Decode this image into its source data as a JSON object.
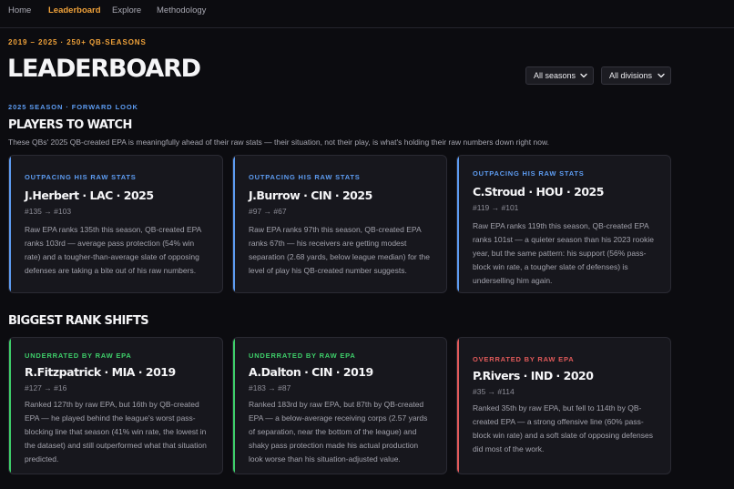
{
  "nav": {
    "items": [
      {
        "label": "Home"
      },
      {
        "label": "Leaderboard"
      },
      {
        "label": "Explore"
      },
      {
        "label": "Methodology"
      }
    ]
  },
  "header": {
    "eyebrow": "2019 – 2025 · 250+ QB-SEASONS",
    "title": "LEADERBOARD"
  },
  "filters": {
    "season": "All seasons",
    "division": "All divisions"
  },
  "colors": {
    "accent": "#f0a23a",
    "underrated": "#5d9cf2",
    "positive": "#3ecf6a",
    "negative": "#e25a5a"
  },
  "players_to_watch": {
    "eyebrow": "2025 SEASON · FORWARD LOOK",
    "title": "PLAYERS TO WATCH",
    "description": "These QBs' 2025 QB-created EPA is meaningfully ahead of their raw stats — their situation, not their play, is what's holding their raw numbers down right now.",
    "cards": [
      {
        "tag": "OUTPACING HIS RAW STATS",
        "name": "J.Herbert · LAC · 2025",
        "rank": "#135 → #103",
        "body": "Raw EPA ranks 135th this season, QB-created EPA ranks 103rd — average pass protection (54% win rate) and a tougher-than-average slate of opposing defenses are taking a bite out of his raw numbers."
      },
      {
        "tag": "OUTPACING HIS RAW STATS",
        "name": "J.Burrow · CIN · 2025",
        "rank": "#97 → #67",
        "body": "Raw EPA ranks 97th this season, QB-created EPA ranks 67th — his receivers are getting modest separation (2.68 yards, below league median) for the level of play his QB-created number suggests."
      },
      {
        "tag": "OUTPACING HIS RAW STATS",
        "name": "C.Stroud · HOU · 2025",
        "rank": "#119 → #101",
        "body": "Raw EPA ranks 119th this season, QB-created EPA ranks 101st — a quieter season than his 2023 rookie year, but the same pattern: his support (56% pass-block win rate, a tougher slate of defenses) is underselling him again."
      }
    ]
  },
  "rank_shifts": {
    "title": "BIGGEST RANK SHIFTS",
    "cards": [
      {
        "tag": "UNDERRATED BY RAW EPA",
        "name": "R.Fitzpatrick · MIA · 2019",
        "rank": "#127 → #16",
        "body": "Ranked 127th by raw EPA, but 16th by QB-created EPA — he played behind the league's worst pass-blocking line that season (41% win rate, the lowest in the dataset) and still outperformed what that situation predicted."
      },
      {
        "tag": "UNDERRATED BY RAW EPA",
        "name": "A.Dalton · CIN · 2019",
        "rank": "#183 → #87",
        "body": "Ranked 183rd by raw EPA, but 87th by QB-created EPA — a below-average receiving corps (2.57 yards of separation, near the bottom of the league) and shaky pass protection made his actual production look worse than his situation-adjusted value."
      },
      {
        "tag": "OVERRATED BY RAW EPA",
        "name": "P.Rivers · IND · 2020",
        "rank": "#35 → #114",
        "body": "Ranked 35th by raw EPA, but fell to 114th by QB-created EPA — a strong offensive line (60% pass-block win rate) and a soft slate of opposing defenses did most of the work."
      }
    ]
  }
}
